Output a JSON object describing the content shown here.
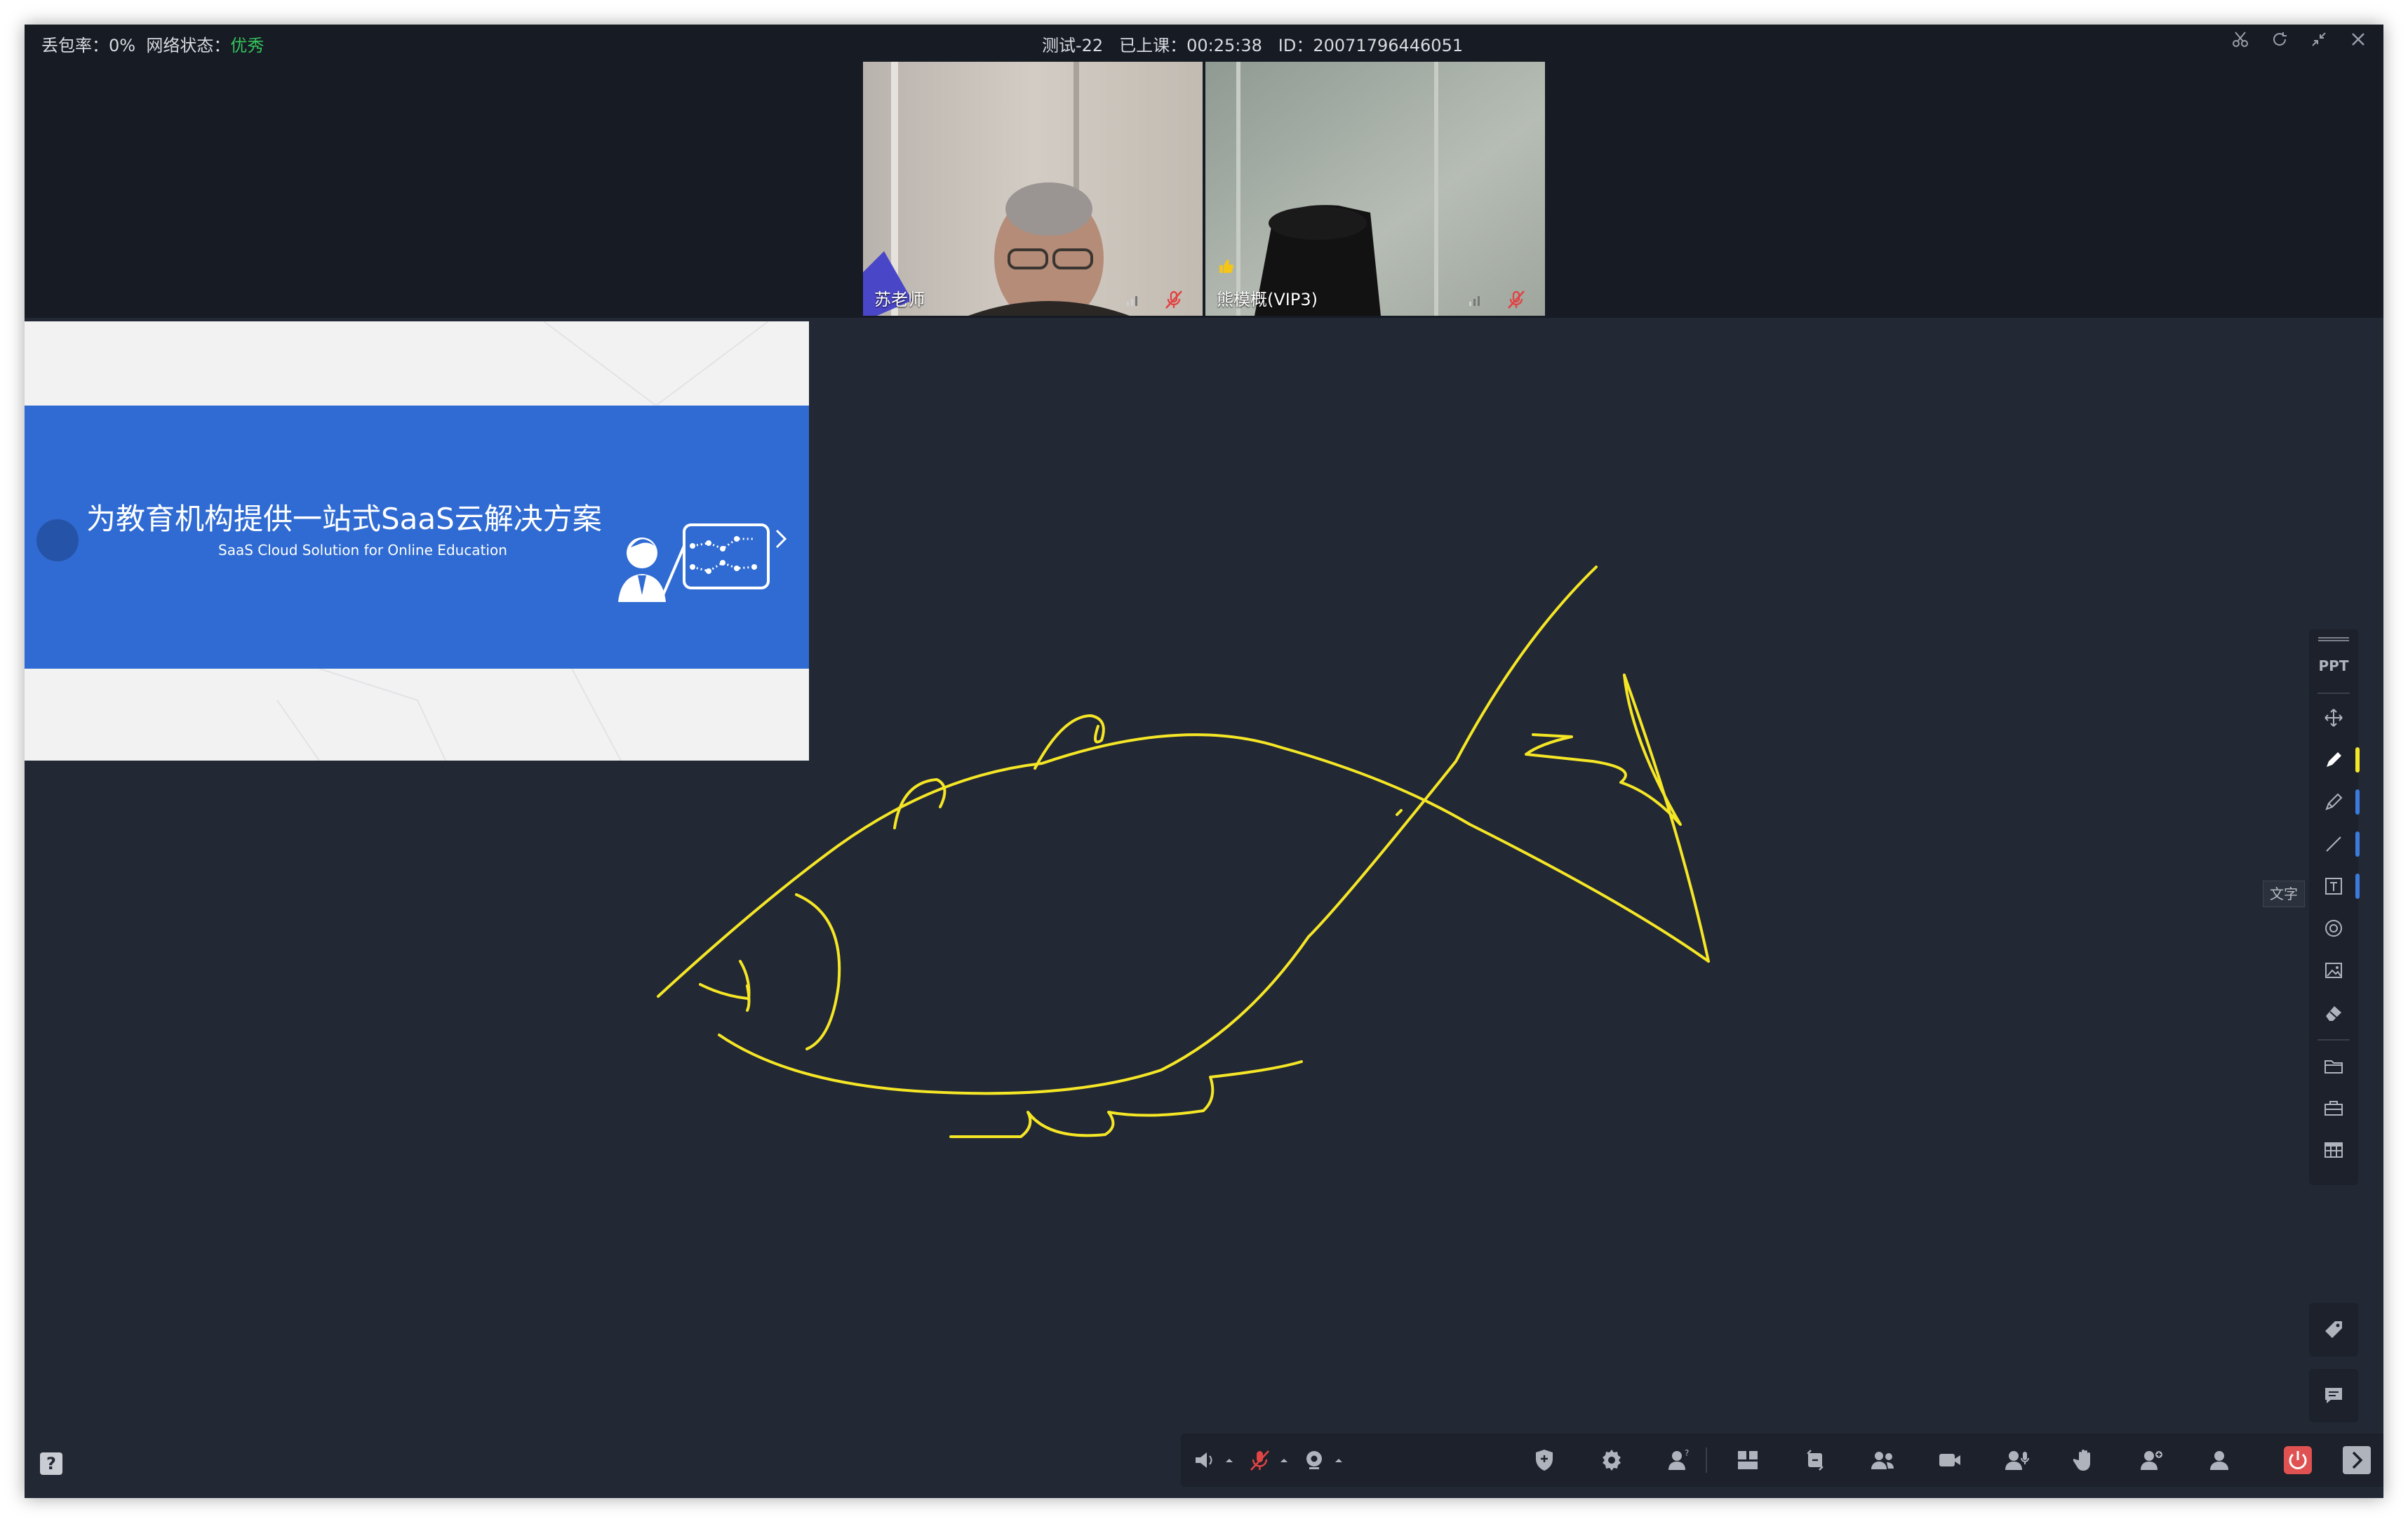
{
  "titlebar": {
    "packet_loss_label": "丢包率：",
    "packet_loss_value": "0%",
    "network_label": "网络状态：",
    "network_value": "优秀",
    "class_name": "测试-22",
    "elapsed_label": "已上课：",
    "elapsed_value": "00:25:38",
    "id_label": "ID：",
    "id_value": "20071796446051",
    "window_icons": [
      "scissors-icon",
      "refresh-icon",
      "shrink-icon",
      "close-icon"
    ]
  },
  "videos": [
    {
      "name": "苏老师",
      "mic": "muted",
      "signal": "signal-bars-icon"
    },
    {
      "name": "熊模概(VIP3)",
      "mic": "muted",
      "signal": "signal-bars-icon",
      "badge": "thumbs-up-icon"
    }
  ],
  "slide": {
    "title": "为教育机构提供一站式SaaS云解决方案",
    "subtitle": "SaaS Cloud Solution for Online Education"
  },
  "whiteboard": {
    "drawing": "fish sketch",
    "stroke_color": "#f5e626"
  },
  "right_toolbar": {
    "items": [
      {
        "icon": "grip-icon"
      },
      {
        "icon": "ppt-icon",
        "label": "PPT"
      },
      {
        "icon": "move-icon"
      },
      {
        "icon": "pen-icon",
        "tag": "#f5e626"
      },
      {
        "icon": "highlighter-icon",
        "tag": "#3a7bdc"
      },
      {
        "icon": "line-icon",
        "tag": "#3a7bdc"
      },
      {
        "icon": "text-icon",
        "tag": "#3a7bdc"
      },
      {
        "icon": "target-icon"
      },
      {
        "icon": "image-icon"
      },
      {
        "icon": "eraser-icon"
      },
      {
        "icon": "folder-icon"
      },
      {
        "icon": "toolbox-icon"
      },
      {
        "icon": "table-icon"
      }
    ],
    "tooltip": "文字"
  },
  "side_buttons": [
    "tag-icon",
    "chat-icon"
  ],
  "bottom_toolbar": [
    "speaker-icon",
    "mic-muted-icon",
    "camera-icon",
    "shield-user-icon",
    "settings-icon",
    "user-question-icon",
    "layout-icon",
    "switch-icon",
    "users-icon",
    "video-icon",
    "mic-user-icon",
    "raise-hand-icon",
    "user-add-icon",
    "user-icon",
    "power-icon",
    "expand-icon"
  ],
  "colors": {
    "background": "#222834",
    "titlebar": "#161b24",
    "good_status": "#35c35a",
    "banner": "#2f6bd2",
    "power": "#e05252"
  }
}
